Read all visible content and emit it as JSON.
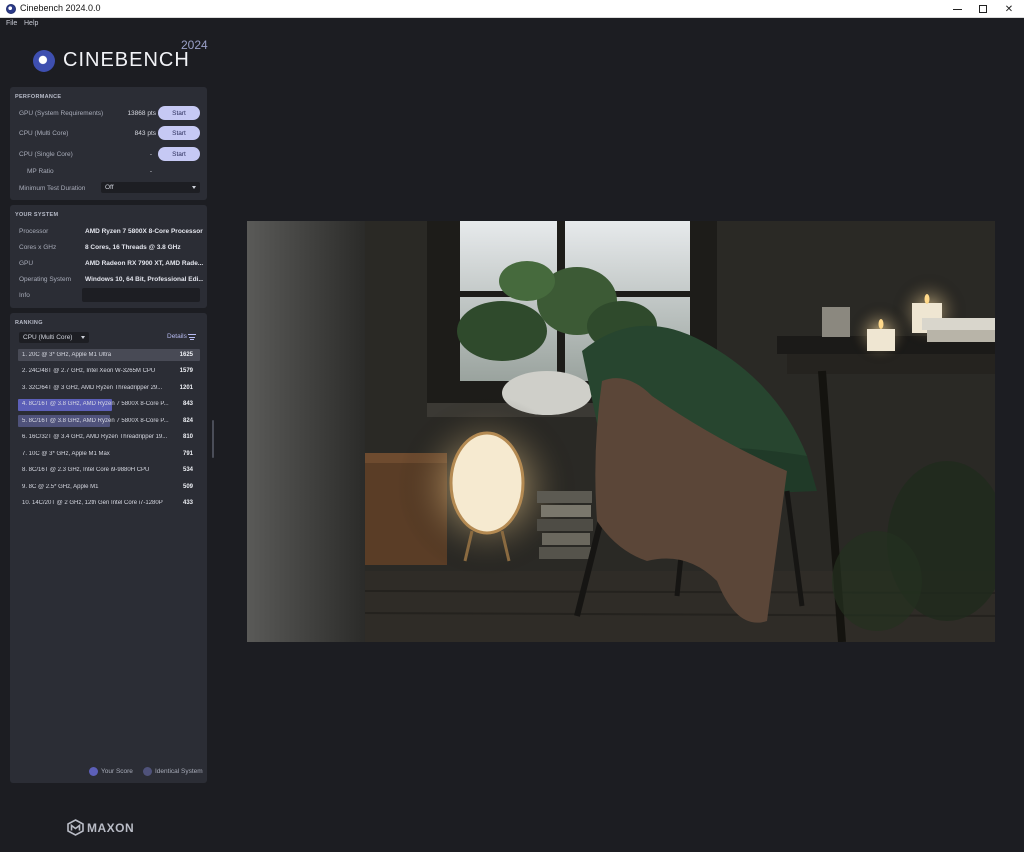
{
  "window": {
    "title": "Cinebench 2024.0.0",
    "minimize_glyph": "–",
    "maximize_glyph": "☐",
    "close_glyph": "✕"
  },
  "menu": [
    "File",
    "Help"
  ],
  "logo": {
    "text": "CINEBENCH",
    "year": "2024"
  },
  "performance": {
    "title": "PERFORMANCE",
    "rows": [
      {
        "label": "GPU (System Requirements)",
        "value": "13868 pts",
        "button": "Start"
      },
      {
        "label": "CPU (Multi Core)",
        "value": "843 pts",
        "button": "Start"
      },
      {
        "label": "CPU (Single Core)",
        "value": "-",
        "button": "Start"
      }
    ],
    "mp_ratio": {
      "label": "MP Ratio",
      "value": "-"
    },
    "min_test_duration": {
      "label": "Minimum Test Duration",
      "value": "Off"
    }
  },
  "your_system": {
    "title": "YOUR SYSTEM",
    "rows": [
      {
        "label": "Processor",
        "value": "AMD Ryzen 7 5800X 8-Core Processor"
      },
      {
        "label": "Cores x GHz",
        "value": "8 Cores, 16 Threads @ 3.8 GHz"
      },
      {
        "label": "GPU",
        "value": "AMD Radeon RX 7900 XT, AMD Rade..."
      },
      {
        "label": "Operating System",
        "value": "Windows 10, 64 Bit, Professional Edi..."
      },
      {
        "label": "Info",
        "value": ""
      }
    ]
  },
  "ranking": {
    "title": "RANKING",
    "dropdown": "CPU (Multi Core)",
    "details_label": "Details",
    "max_score": 1625,
    "colors": {
      "reference": "#484a55",
      "yours": "#5c5fb8",
      "identical": "#4f527a"
    },
    "items": [
      {
        "label": "1. 20C @ 3* GHz, Apple M1 Ultra",
        "score": "1625",
        "value": 1625,
        "kind": "reference"
      },
      {
        "label": "2. 24C/48T @ 2.7 GHz, Intel Xeon W-3265M CPU",
        "score": "1579",
        "value": 1579,
        "kind": "none"
      },
      {
        "label": "3. 32C/64T @ 3 GHz, AMD Ryzen Threadripper 29...",
        "score": "1201",
        "value": 1201,
        "kind": "none"
      },
      {
        "label": "4. 8C/16T @ 3.8 GHz, AMD Ryzen 7 5800X 8-Core P...",
        "score": "843",
        "value": 843,
        "kind": "yours"
      },
      {
        "label": "5. 8C/16T @ 3.8 GHz, AMD Ryzen 7 5800X 8-Core P...",
        "score": "824",
        "value": 824,
        "kind": "identical"
      },
      {
        "label": "6. 16C/32T @ 3.4 GHz, AMD Ryzen Threadripper 19...",
        "score": "810",
        "value": 810,
        "kind": "none"
      },
      {
        "label": "7. 10C @ 3* GHz, Apple M1 Max",
        "score": "791",
        "value": 791,
        "kind": "none"
      },
      {
        "label": "8. 8C/16T @ 2.3 GHz, Intel Core i9-9880H CPU",
        "score": "534",
        "value": 534,
        "kind": "none"
      },
      {
        "label": "9. 8C @ 2.5* GHz, Apple M1",
        "score": "509",
        "value": 509,
        "kind": "none"
      },
      {
        "label": "10. 14C/20T @ 2 GHz, 12th Gen Intel Core i7-1280P",
        "score": "433",
        "value": 433,
        "kind": "none"
      }
    ],
    "legend": {
      "yours": "Your Score",
      "identical": "Identical System"
    }
  },
  "brand": {
    "text": "MAXON"
  }
}
